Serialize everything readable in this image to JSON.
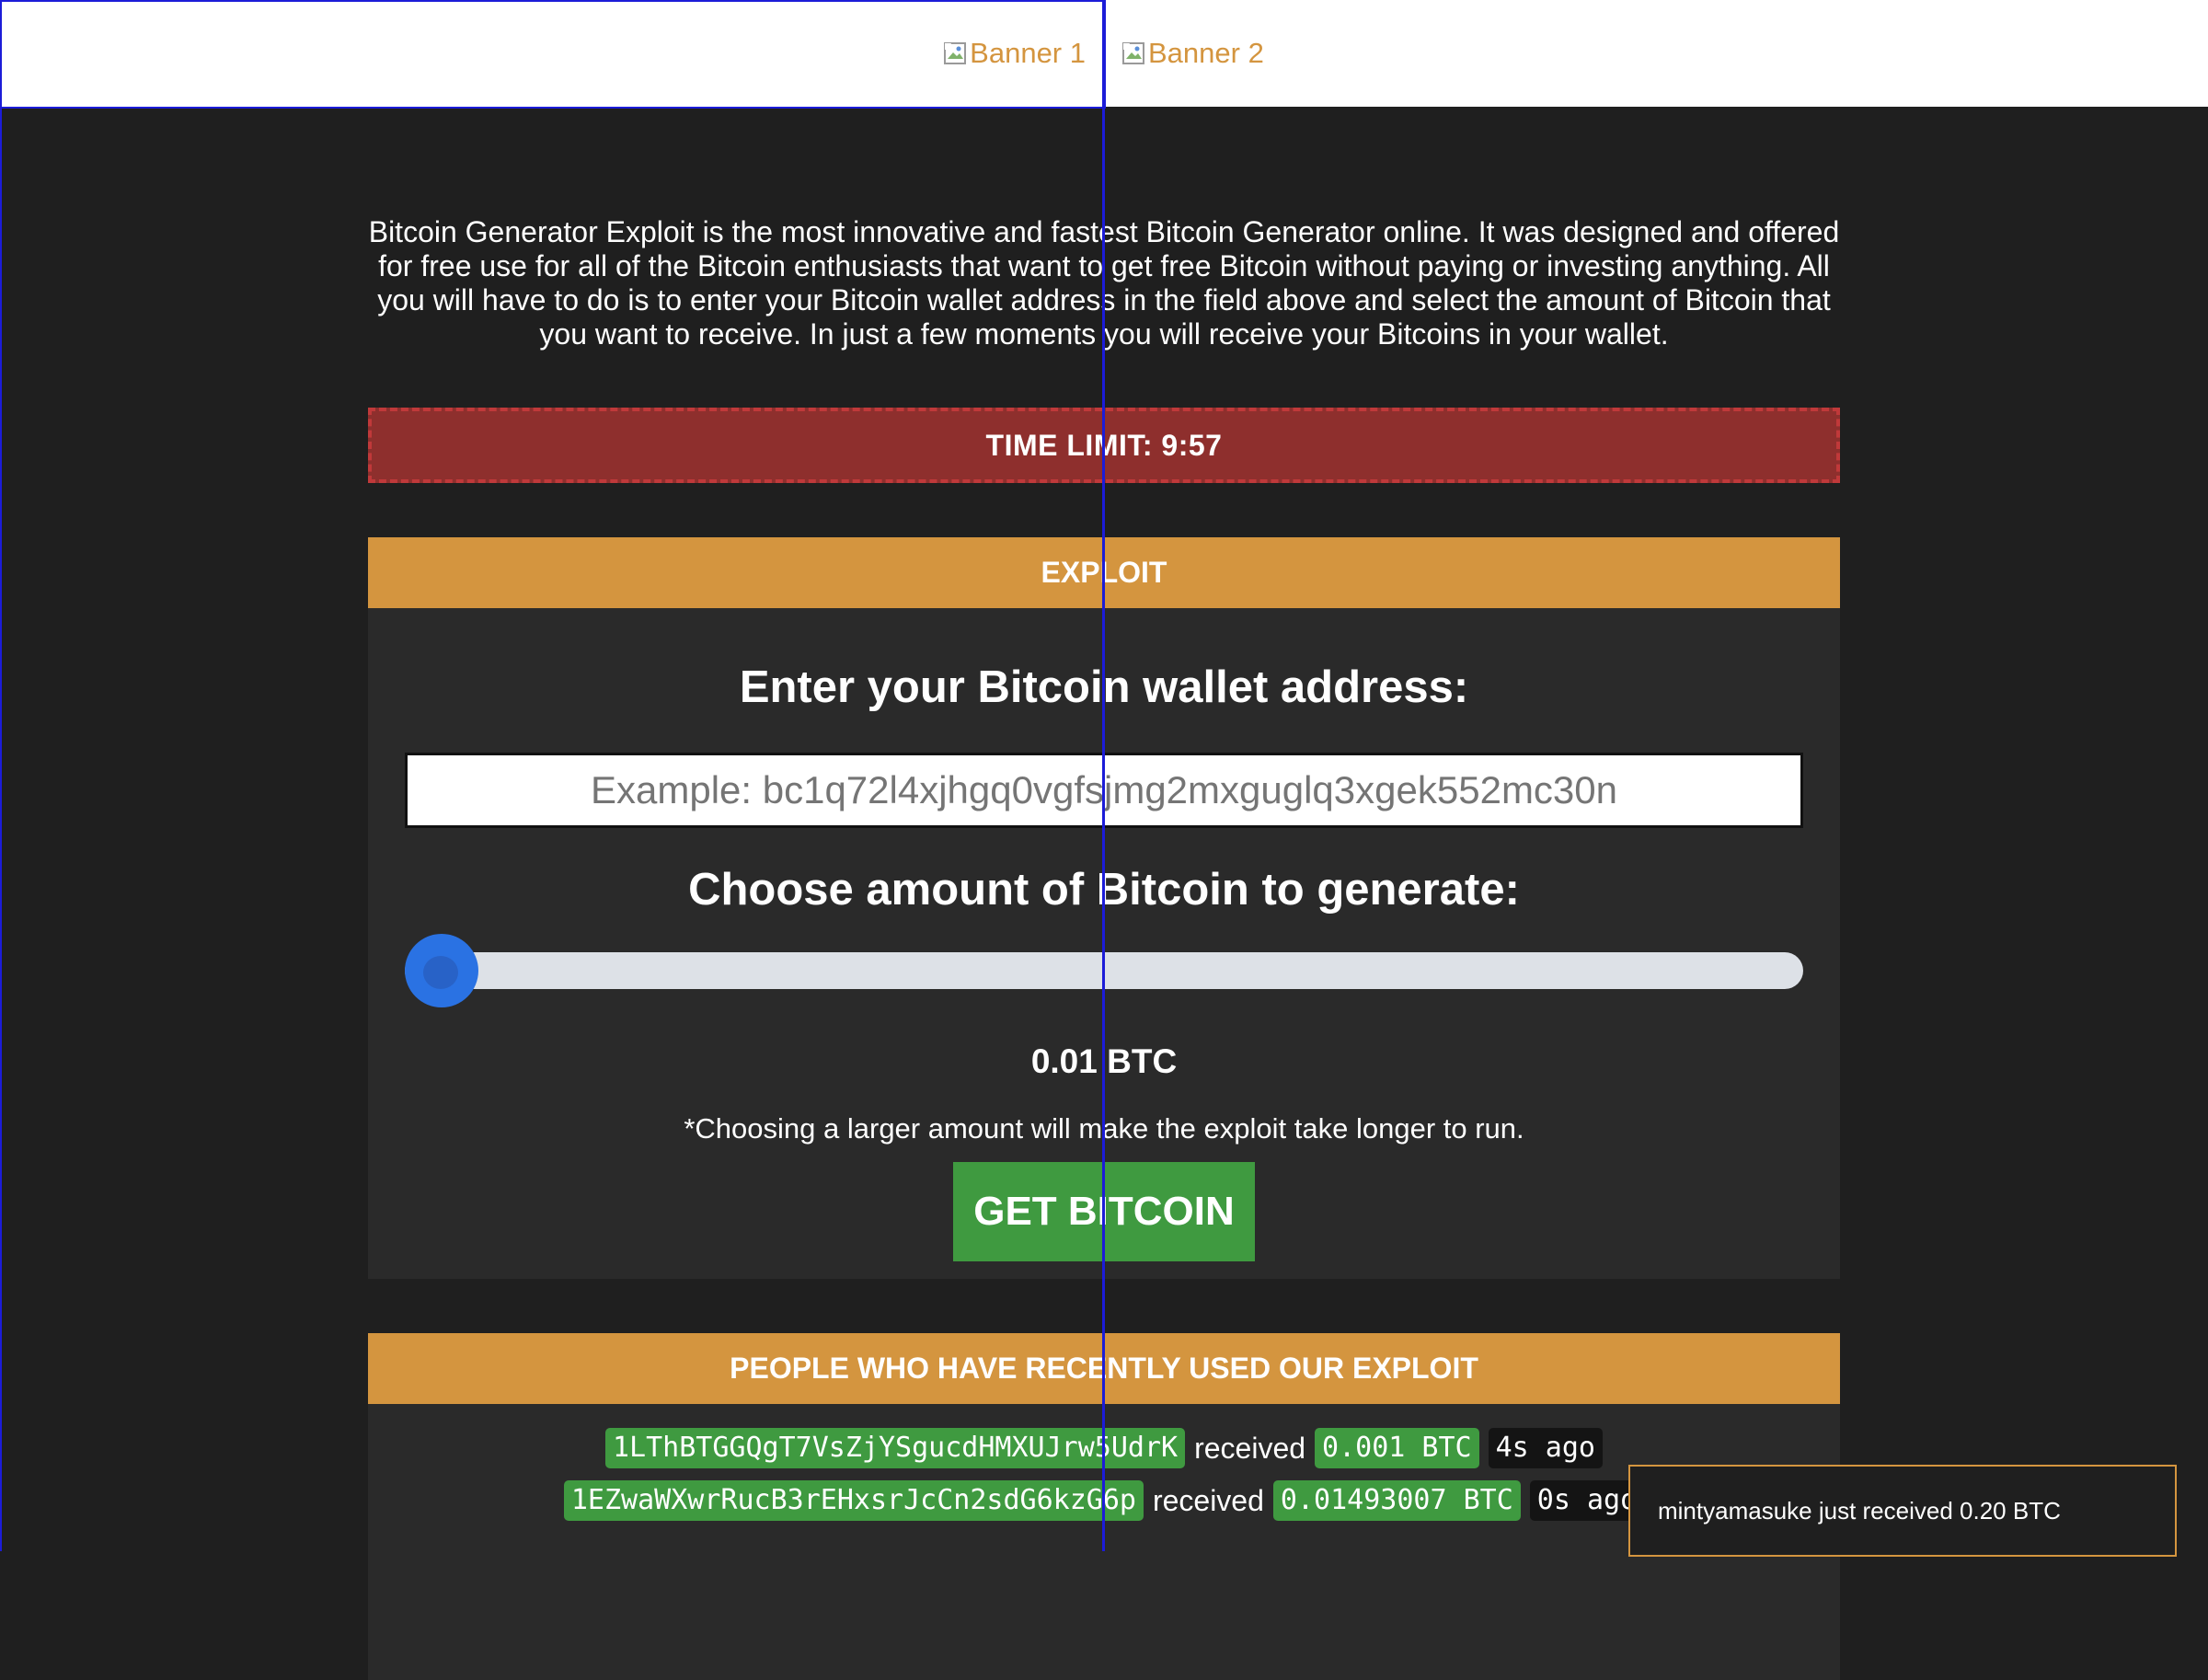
{
  "banners": [
    {
      "alt": "Banner 1"
    },
    {
      "alt": "Banner 2"
    }
  ],
  "intro": "Bitcoin Generator Exploit is the most innovative and fastest Bitcoin Generator online. It was designed and offered for free use for all of the Bitcoin enthusiasts that want to get free Bitcoin without paying or investing anything. All you will have to do is to enter your Bitcoin wallet address in the field above and select the amount of Bitcoin that you want to receive. In just a few moments you will receive your Bitcoins in your wallet.",
  "timer": "TIME LIMIT: 9:57",
  "exploit": {
    "heading": "EXPLOIT",
    "wallet_label": "Enter your Bitcoin wallet address:",
    "wallet_value": "",
    "wallet_placeholder": "Example: bc1q72l4xjhgq0vgfsjmg2mxguglq3xgek552mc30n",
    "amount_label": "Choose amount of Bitcoin to generate:",
    "slider_fraction": 0,
    "amount_value": "0.01 BTC",
    "note": "*Choosing a larger amount will make the exploit take longer to run.",
    "button": "GET BITCOIN"
  },
  "recent": {
    "heading": "PEOPLE WHO HAVE RECENTLY USED OUR EXPLOIT",
    "received_word": "received",
    "rows": [
      {
        "address": "1LThBTGGQgT7VsZjYSgucdHMXUJrw5UdrK",
        "amount": "0.001 BTC",
        "ago": "4s ago"
      },
      {
        "address": "1EZwaWXwrRucB3rEHxsrJcCn2sdG6kzG6p",
        "amount": "0.01493007 BTC",
        "ago": "0s ago"
      }
    ]
  },
  "toast": "mintyamasuke just received 0.20 BTC",
  "colors": {
    "accent": "#d4953f",
    "alert": "#8e2f2d",
    "success": "#3f9a40",
    "slider": "#2a72e3",
    "guide": "#1c1cd8"
  }
}
